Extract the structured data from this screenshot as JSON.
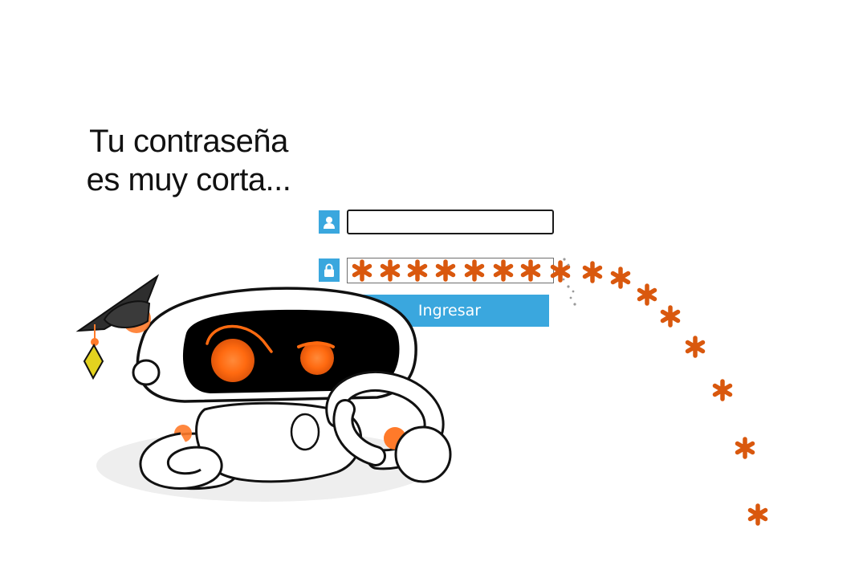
{
  "speech": {
    "line1": "Tu contraseña",
    "line2": "es muy corta..."
  },
  "login_form": {
    "username_icon": "user-icon",
    "password_icon": "lock-icon",
    "username_value": "",
    "password_mask_char": "✱",
    "password_visible_chars": 8,
    "button_label": "Ingresar"
  },
  "mascot": {
    "description_icon": "robot-mascot-with-graduation-cap",
    "eye_color": "#ff6a10",
    "accent_color": "#ff7a2a"
  },
  "colors": {
    "accent_blue": "#3aa7de",
    "asterisk_orange": "#d9580e",
    "tassel_yellow": "#e3d21f"
  }
}
